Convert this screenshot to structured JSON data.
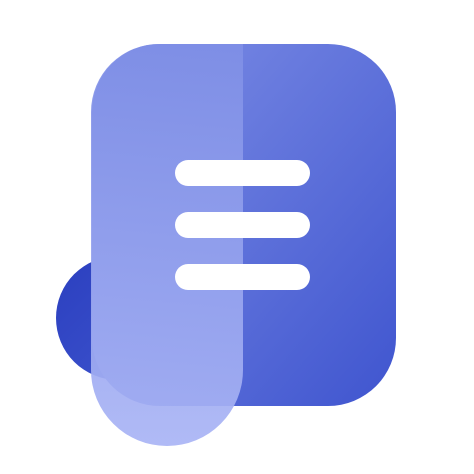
{
  "icon": {
    "name": "document-list-icon",
    "colors": {
      "back_circle": "#2b3fbf",
      "card_dark": "#3f55cf",
      "card_light": "#a9b4f5",
      "card_mid": "#7f8fe6",
      "lines": "#ffffff"
    },
    "line_count": 3
  }
}
